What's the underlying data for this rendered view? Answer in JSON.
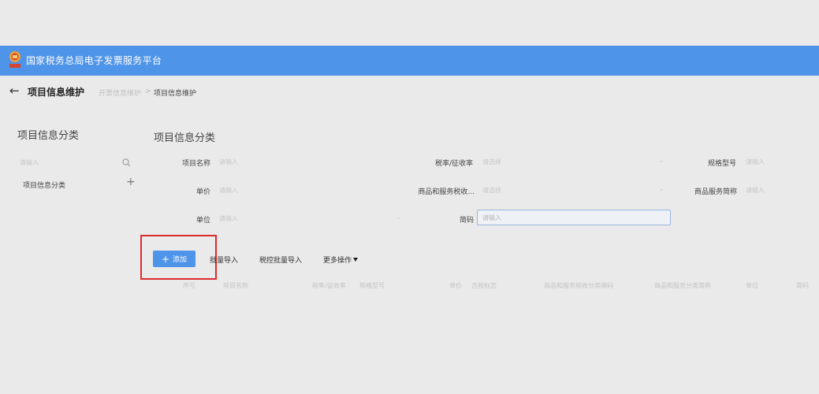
{
  "header": {
    "app_title": "国家税务总局电子发票服务平台",
    "brand_color": "#4e94e8",
    "logo_icon": "tax-emblem-icon"
  },
  "page": {
    "title": "项目信息维护",
    "back_icon": "arrow-left-icon",
    "breadcrumb": [
      "开票信息维护",
      ">",
      "项目信息维护"
    ]
  },
  "sidebar": {
    "title": "项目信息分类",
    "search_placeholder": "请输入",
    "search_icon": "search-icon",
    "tree_items": [
      {
        "label": "项目信息分类"
      }
    ],
    "add_icon": "+"
  },
  "main": {
    "title": "项目信息分类",
    "filters": {
      "item_name": {
        "label": "项目名称",
        "placeholder": "请输入"
      },
      "tax_rate": {
        "label": "税率/征收率",
        "placeholder": "请选择"
      },
      "spec_model": {
        "label": "规格型号",
        "placeholder": "请输入"
      },
      "unit_price": {
        "label": "单价",
        "placeholder": "请输入"
      },
      "tax_code": {
        "label": "商品和服务税收...",
        "placeholder": "请选择"
      },
      "service_short": {
        "label": "商品服务简称",
        "placeholder": "请输入"
      },
      "unit": {
        "label": "单位",
        "placeholder": "请输入"
      },
      "short_code": {
        "label": "简码",
        "placeholder": "请输入"
      }
    },
    "toolbar": {
      "add_label": "添加",
      "add_icon": "+",
      "batch_import": "批量导入",
      "tax_batch_import": "税控批量导入",
      "more_actions": "更多操作"
    },
    "highlight_color": "#dd2b2b",
    "table_columns": [
      "序号",
      "项目名称",
      "税率/征收率",
      "规格型号",
      "单价",
      "含税标志",
      "商品和服务税收分类编码",
      "商品和服务分类简称",
      "单位",
      "简码"
    ]
  }
}
